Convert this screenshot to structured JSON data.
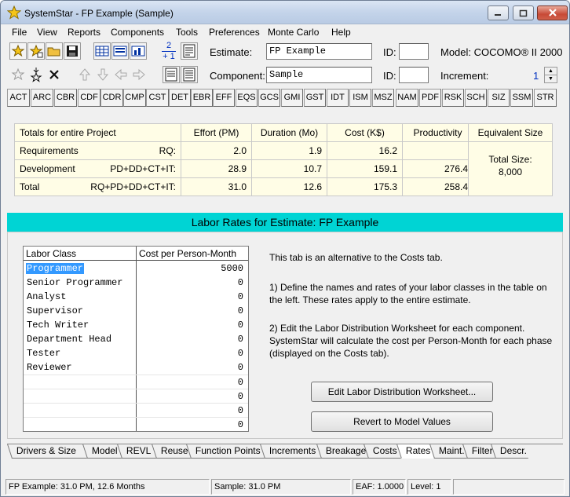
{
  "window": {
    "title": "SystemStar - FP Example (Sample)"
  },
  "menu": [
    "File",
    "View",
    "Reports",
    "Components",
    "Tools",
    "Preferences",
    "Monte Carlo",
    "Help"
  ],
  "fields": {
    "estimate_label": "Estimate:",
    "estimate_value": "FP Example",
    "id_label": "ID:",
    "id_value": "",
    "model_text": "Model: COCOMO® II 2000",
    "component_label": "Component:",
    "component_value": "Sample",
    "id2_label": "ID:",
    "id2_value": "",
    "increment_label": "Increment:",
    "increment_value": "1"
  },
  "toolbar": {
    "renumber_top": "2",
    "renumber_bottom": "+ 1"
  },
  "codes": [
    "ACT",
    "ARC",
    "CBR",
    "CDF",
    "CDR",
    "CMP",
    "CST",
    "DET",
    "EBR",
    "EFF",
    "EQS",
    "GCS",
    "GMI",
    "GST",
    "IDT",
    "ISM",
    "MSZ",
    "NAM",
    "PDF",
    "RSK",
    "SCH",
    "SIZ",
    "SSM",
    "STR"
  ],
  "summary": {
    "header": [
      "Totals for entire Project",
      "Effort (PM)",
      "Duration (Mo)",
      "Cost (K$)",
      "Productivity"
    ],
    "rows": [
      {
        "name": "Requirements",
        "code": "RQ:",
        "effort": "2.0",
        "duration": "1.9",
        "cost": "16.2",
        "productivity": ""
      },
      {
        "name": "Development",
        "code": "PD+DD+CT+IT:",
        "effort": "28.9",
        "duration": "10.7",
        "cost": "159.1",
        "productivity": "276.4"
      },
      {
        "name": "Total",
        "code": "RQ+PD+DD+CT+IT:",
        "effort": "31.0",
        "duration": "12.6",
        "cost": "175.3",
        "productivity": "258.4"
      }
    ],
    "equivalent": {
      "title": "Equivalent Size",
      "line1": "Total Size:",
      "line2": "8,000"
    }
  },
  "banner": "Labor Rates for Estimate: FP Example",
  "labor": {
    "col1": "Labor Class",
    "col2": "Cost per Person-Month",
    "rows": [
      {
        "name": "Programmer",
        "value": "5000"
      },
      {
        "name": "Senior Programmer",
        "value": "0"
      },
      {
        "name": "Analyst",
        "value": "0"
      },
      {
        "name": "Supervisor",
        "value": "0"
      },
      {
        "name": "Tech Writer",
        "value": "0"
      },
      {
        "name": "Department Head",
        "value": "0"
      },
      {
        "name": "Tester",
        "value": "0"
      },
      {
        "name": "Reviewer",
        "value": "0"
      },
      {
        "name": "",
        "value": "0"
      },
      {
        "name": "",
        "value": "0"
      },
      {
        "name": "",
        "value": "0"
      },
      {
        "name": "",
        "value": "0"
      }
    ]
  },
  "info": {
    "p1": "This tab is an alternative to the Costs tab.",
    "p2": "1) Define the names and rates of your labor classes in the table on the left.  These rates apply to the entire estimate.",
    "p3": "2) Edit the Labor Distribution Worksheet for each component. SystemStar will calculate the cost per Person-Month for each phase (displayed on the Costs tab).",
    "btn1": "Edit Labor Distribution Worksheet...",
    "btn2": "Revert to Model Values"
  },
  "tabs": [
    "Drivers & Size",
    "Model",
    "REVL",
    "Reuse",
    "Function Points",
    "Increments",
    "Breakage",
    "Costs",
    "Rates",
    "Maint.",
    "Filter",
    "Descr."
  ],
  "active_tab": "Rates",
  "status": {
    "left": "FP Example:  31.0 PM,  12.6 Months",
    "mid": "Sample:  31.0 PM",
    "eaf": "EAF: 1.0000",
    "level": "Level:   1"
  },
  "colors": {
    "banner": "#00d4d4",
    "summary_bg": "#fffde6",
    "selection": "#3399ff"
  }
}
